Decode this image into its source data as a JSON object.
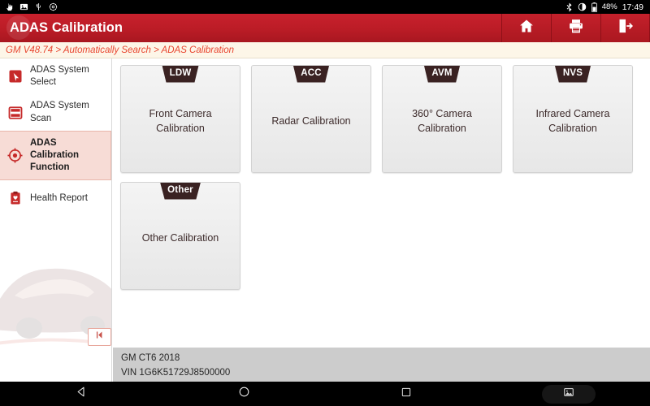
{
  "status_bar": {
    "left_icons": [
      {
        "name": "touch-pointer-icon"
      },
      {
        "name": "screenshot-image-icon"
      },
      {
        "name": "usb-icon"
      },
      {
        "name": "settings-gear-icon"
      }
    ],
    "bluetooth_icon": "bluetooth-icon",
    "brightness_icon": "brightness-contrast-icon",
    "battery_icon": "battery-icon",
    "battery_percent": "48%",
    "clock": "17:49"
  },
  "header": {
    "title": "ADAS Calibration",
    "background_color": "#bb1c26",
    "actions": [
      {
        "name": "home-button",
        "icon": "home-icon"
      },
      {
        "name": "print-button",
        "icon": "printer-icon"
      },
      {
        "name": "exit-button",
        "icon": "exit-door-icon"
      }
    ]
  },
  "breadcrumb": {
    "text": "GM V48.74 > Automatically Search > ADAS Calibration",
    "color": "#e8452f",
    "background_color": "#fdf6e8"
  },
  "sidebar": {
    "collapse_label": "⧏|",
    "items": [
      {
        "label": "ADAS System Select",
        "icon": "cursor-select-icon",
        "active": false
      },
      {
        "label": "ADAS System Scan",
        "icon": "system-scan-icon",
        "active": false
      },
      {
        "label": "ADAS Calibration Function",
        "icon": "target-crosshair-icon",
        "active": true
      },
      {
        "label": "Health Report",
        "icon": "clipboard-health-icon",
        "active": false
      }
    ],
    "active_background": "#f7dcd6"
  },
  "main": {
    "cards": [
      {
        "badge": "LDW",
        "label": "Front Camera Calibration"
      },
      {
        "badge": "ACC",
        "label": "Radar Calibration"
      },
      {
        "badge": "AVM",
        "label": "360° Camera Calibration"
      },
      {
        "badge": "NVS",
        "label": "Infrared Camera Calibration"
      },
      {
        "badge": "Other",
        "label": "Other Calibration"
      }
    ],
    "badge_color": "#3a2222"
  },
  "vehicle_info": {
    "model": "GM CT6 2018",
    "vin": "VIN 1G6K51729J8500000",
    "background_color": "#cccccc"
  },
  "nav_bar": {
    "buttons": [
      {
        "name": "nav-back-button",
        "icon": "triangle-back-icon"
      },
      {
        "name": "nav-home-button",
        "icon": "circle-home-icon"
      },
      {
        "name": "nav-recents-button",
        "icon": "square-recents-icon"
      },
      {
        "name": "nav-screenshot-button",
        "icon": "image-screenshot-icon"
      }
    ]
  }
}
